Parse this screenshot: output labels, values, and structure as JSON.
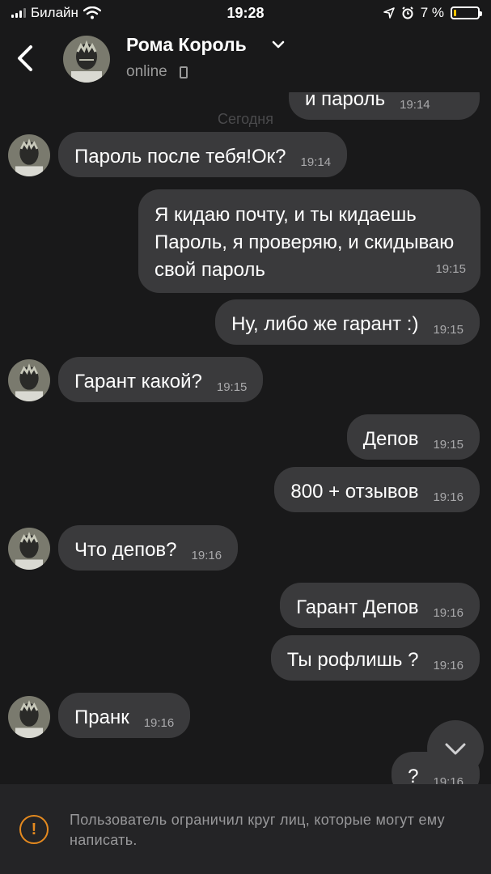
{
  "status_bar": {
    "carrier": "Билайн",
    "time": "19:28",
    "battery_percent": "7 %",
    "battery_level": 0.07
  },
  "header": {
    "contact_name": "Рома Король",
    "contact_status": "online"
  },
  "chat": {
    "date_label": "Сегодня",
    "messages": [
      {
        "side": "out",
        "text": "и пароль",
        "time": "19:14"
      },
      {
        "side": "in",
        "text": "Пароль после тебя!Ок?",
        "time": "19:14"
      },
      {
        "side": "out",
        "text": "Я кидаю почту, и ты кидаешь Пароль, я проверяю, и скидываю свой пароль",
        "time": "19:15"
      },
      {
        "side": "out",
        "text": "Ну, либо же гарант :)",
        "time": "19:15"
      },
      {
        "side": "in",
        "text": "Гарант какой?",
        "time": "19:15"
      },
      {
        "side": "out",
        "text": "Депов",
        "time": "19:15"
      },
      {
        "side": "out",
        "text": "800 + отзывов",
        "time": "19:16"
      },
      {
        "side": "in",
        "text": "Что депов?",
        "time": "19:16"
      },
      {
        "side": "out",
        "text": "Гарант Депов",
        "time": "19:16"
      },
      {
        "side": "out",
        "text": "Ты рофлишь ?",
        "time": "19:16"
      },
      {
        "side": "in",
        "text": "Пранк",
        "time": "19:16"
      },
      {
        "side": "out",
        "text": "?",
        "time": "19:16"
      }
    ]
  },
  "footer": {
    "restriction_text": "Пользователь ограничил круг лиц, которые могут ему написать."
  },
  "icons": {
    "back": "chevron-left-icon",
    "expand": "chevron-down-icon",
    "scroll_down": "chevron-down-icon",
    "warning": "warning-icon",
    "device": "mobile-phone-icon"
  },
  "colors": {
    "background": "#19191a",
    "bubble": "#3a3a3c",
    "footer": "#242426",
    "warning": "#e58a1f",
    "battery_low": "#f5c400"
  }
}
